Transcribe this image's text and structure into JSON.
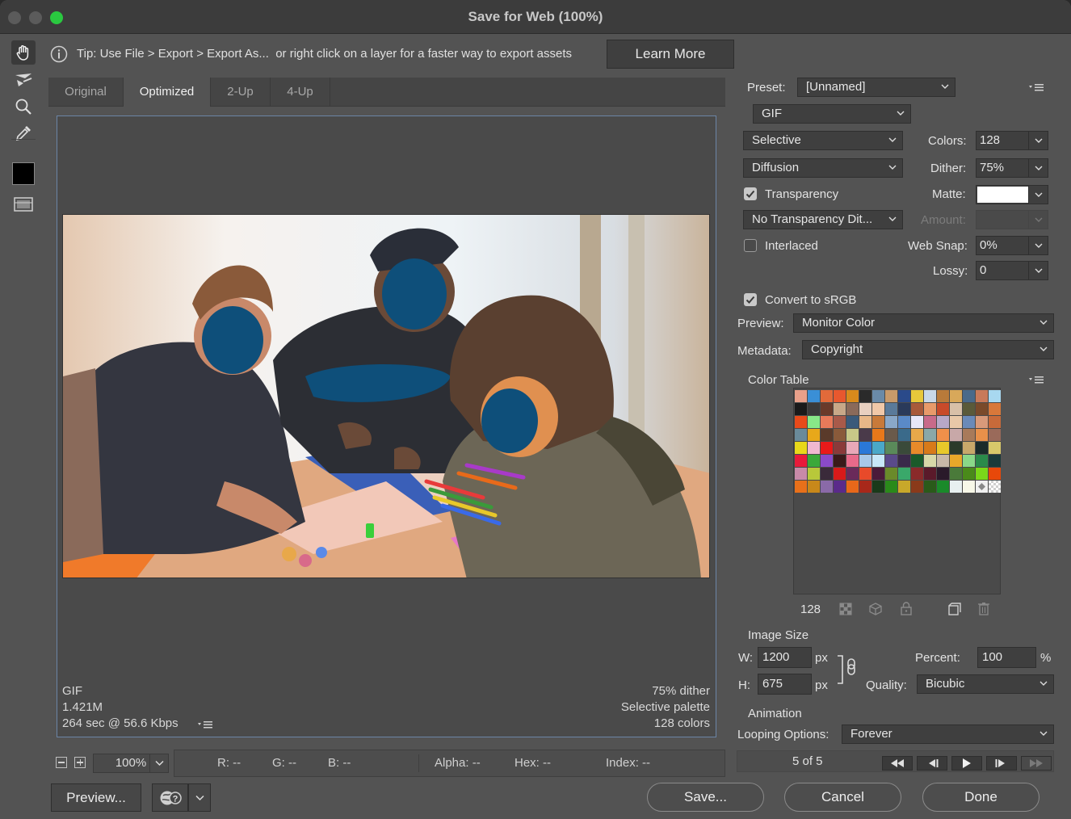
{
  "window": {
    "title": "Save for Web (100%)",
    "traffic_colors": [
      "#5b5b5b",
      "#5b5b5b",
      "#2ac840"
    ]
  },
  "tools": [
    "hand-icon",
    "slice-select-icon",
    "zoom-icon",
    "eyedropper-icon",
    "eyedropper-color-swatch",
    "toggle-slices-icon"
  ],
  "tip": {
    "text": "Tip: Use File > Export > Export As...  or right click on a layer for a faster way to export assets",
    "learn_more": "Learn More"
  },
  "tabs": [
    "Original",
    "Optimized",
    "2-Up",
    "4-Up"
  ],
  "selected_tab": "Optimized",
  "preview_info": {
    "format": "GIF",
    "size": "1.421M",
    "time": "264 sec @ 56.6 Kbps",
    "dither": "75% dither",
    "palette": "Selective palette",
    "colors": "128 colors"
  },
  "zoom": {
    "value": "100%"
  },
  "readouts": {
    "r": "R: --",
    "g": "G: --",
    "b": "B: --",
    "alpha": "Alpha: --",
    "hex": "Hex: --",
    "index": "Index: --"
  },
  "buttons": {
    "preview": "Preview...",
    "save": "Save...",
    "cancel": "Cancel",
    "done": "Done"
  },
  "settings": {
    "preset_label": "Preset:",
    "preset": "[Unnamed]",
    "format": "GIF",
    "reduction": "Selective",
    "colors_label": "Colors:",
    "colors": "128",
    "dither_algo": "Diffusion",
    "dither_label": "Dither:",
    "dither": "75%",
    "transparency_label": "Transparency",
    "transparency_checked": true,
    "matte_label": "Matte:",
    "matte_color": "#ffffff",
    "transparency_dither": "No Transparency Dit...",
    "amount_label": "Amount:",
    "interlaced_label": "Interlaced",
    "interlaced_checked": false,
    "websnap_label": "Web Snap:",
    "websnap": "0%",
    "lossy_label": "Lossy:",
    "lossy": "0",
    "srgb_label": "Convert to sRGB",
    "srgb_checked": true,
    "preview_label": "Preview:",
    "preview": "Monitor Color",
    "metadata_label": "Metadata:",
    "metadata": "Copyright"
  },
  "color_table": {
    "title": "Color Table",
    "count": "128",
    "swatches": [
      "#e8a08a",
      "#3a8fd6",
      "#e26a3a",
      "#e8582e",
      "#d88a1c",
      "#2a2a2a",
      "#6a8aa8",
      "#c89a6a",
      "#2a4a8a",
      "#e8c83a",
      "#c8d8e8",
      "#b87a3a",
      "#d8a85a",
      "#4a6a8a",
      "#c87a5a",
      "#a8d8f0",
      "#1a1a1a",
      "#3a3a3a",
      "#6a3a2a",
      "#c8a888",
      "#8a6a5a",
      "#e8d0c0",
      "#f0c8a8",
      "#5a7a9a",
      "#2a3a5a",
      "#a85a3a",
      "#e89a6a",
      "#c84a2a",
      "#d8c0a8",
      "#5a5a3a",
      "#7a4a2a",
      "#d8783a",
      "#e84a1a",
      "#88e888",
      "#e87a5a",
      "#a85a4a",
      "#3a5a7a",
      "#e8b888",
      "#c87a3a",
      "#8aa8c8",
      "#5a8ac8",
      "#e8e8f8",
      "#c86a8a",
      "#b8a8c8",
      "#e8c8a8",
      "#6a8ab8",
      "#d89a7a",
      "#c86a3a",
      "#6a8a9a",
      "#e8a81a",
      "#5a3a2a",
      "#8a5a3a",
      "#c8c888",
      "#4a3a4a",
      "#e8781a",
      "#6a5a4a",
      "#3a6a8a",
      "#e8a84a",
      "#8aa8a8",
      "#f0904a",
      "#c8a8a8",
      "#a87a5a",
      "#e8904a",
      "#9a6a5a",
      "#e8d81a",
      "#f0b8d0",
      "#e81a1a",
      "#8a3a3a",
      "#e8a8b8",
      "#2a78d8",
      "#4aa8c8",
      "#5a8a5a",
      "#3a4a3a",
      "#e88a2a",
      "#d87a1a",
      "#e8c82a",
      "#2a3a2a",
      "#c8a86a",
      "#1a2a2a",
      "#d8c86a",
      "#e81a3a",
      "#3aa83a",
      "#8a4ac8",
      "#3a1a1a",
      "#e86a8a",
      "#a8c8e8",
      "#c8e8f8",
      "#5a4a8a",
      "#3a2a4a",
      "#1a5a2a",
      "#d8d8a8",
      "#c8b8a8",
      "#e8a82a",
      "#8ad888",
      "#2a8a4a",
      "#1a3a3a",
      "#c88aa8",
      "#b8c83a",
      "#3a2a3a",
      "#d81a1a",
      "#6a2a5a",
      "#e84a2a",
      "#4a1a3a",
      "#6a8a2a",
      "#3aa86a",
      "#8a2a2a",
      "#5a1a2a",
      "#2a1a2a",
      "#4a7a3a",
      "#4a8a1a",
      "#7ad81a",
      "#e8480a",
      "#e8701a",
      "#c8881a",
      "#8a6aa8",
      "#5a2a8a",
      "#e8681a",
      "#a8281a",
      "#1a3a1a",
      "#2a8a1a",
      "#c8a82a",
      "#8a3a1a",
      "#2a5a1a",
      "#1a8a2a",
      "#e8f0f0",
      "#f8f8e8",
      "transparent-diamond",
      "transparent-check"
    ]
  },
  "image_size": {
    "title": "Image Size",
    "w_label": "W:",
    "w": "1200",
    "h_label": "H:",
    "h": "675",
    "px": "px",
    "percent_label": "Percent:",
    "percent": "100",
    "percent_unit": "%",
    "quality_label": "Quality:",
    "quality": "Bicubic"
  },
  "animation": {
    "title": "Animation",
    "looping_label": "Looping Options:",
    "looping": "Forever",
    "frame": "5 of 5"
  }
}
